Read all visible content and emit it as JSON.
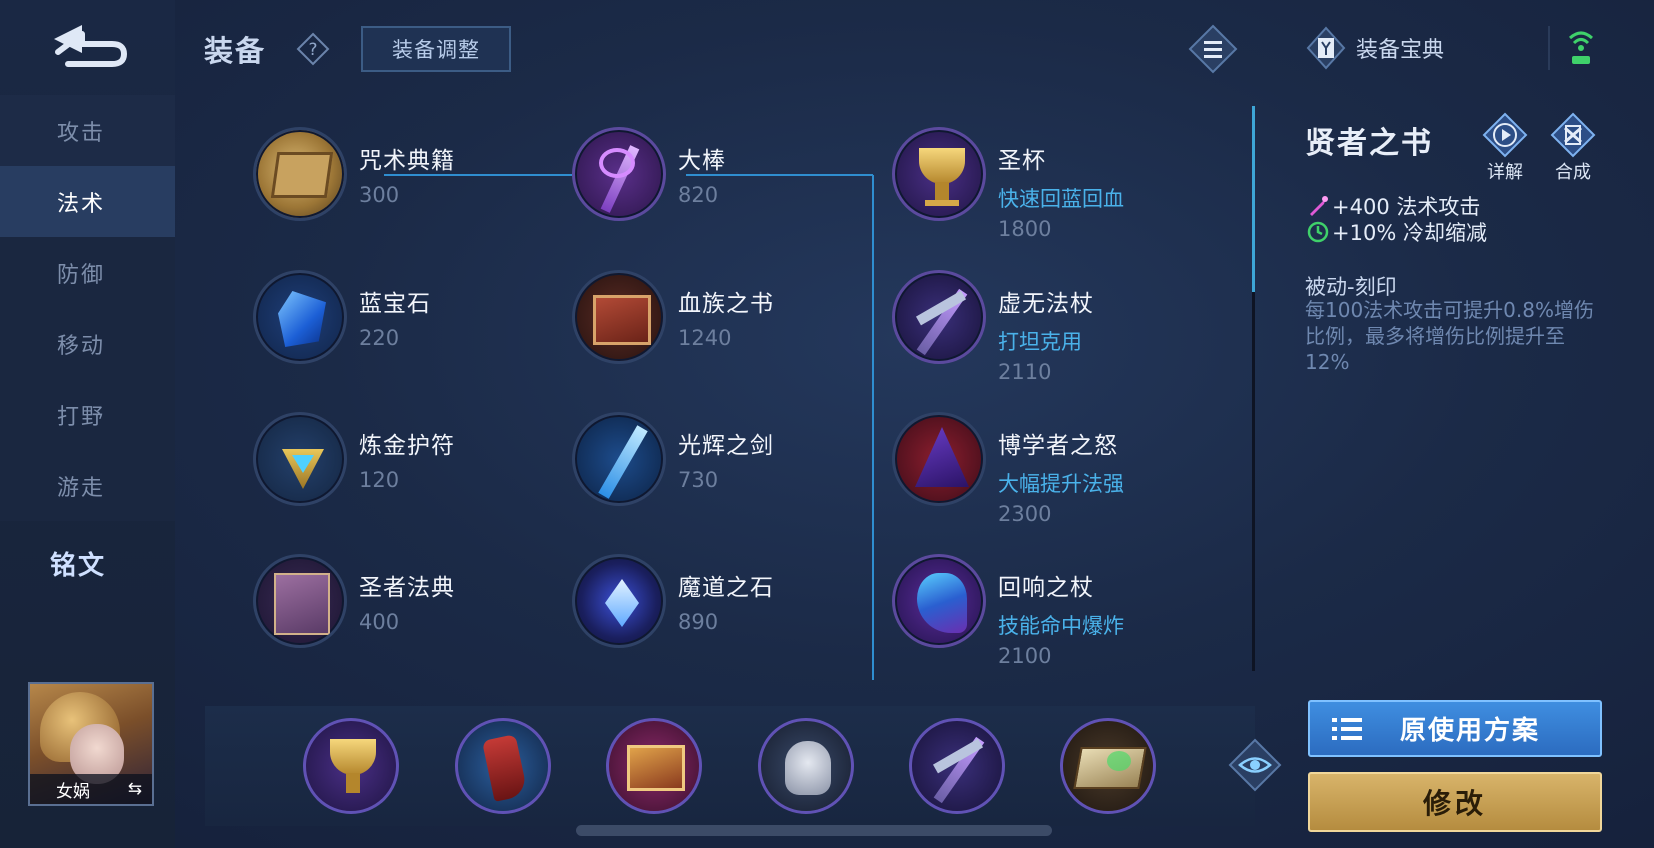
{
  "header": {
    "title": "装备",
    "adjust_button": "装备调整",
    "codex_label": "装备宝典"
  },
  "sidebar": {
    "items": [
      {
        "label": "攻击"
      },
      {
        "label": "法术"
      },
      {
        "label": "防御"
      },
      {
        "label": "移动"
      },
      {
        "label": "打野"
      },
      {
        "label": "游走"
      },
      {
        "label": "铭文"
      }
    ],
    "active": "法术",
    "hero_name": "女娲"
  },
  "items": {
    "col1": [
      {
        "name": "咒术典籍",
        "price": "300",
        "icon": "wooden-book-icon"
      },
      {
        "name": "蓝宝石",
        "price": "220",
        "icon": "blue-gem-icon"
      },
      {
        "name": "炼金护符",
        "price": "120",
        "icon": "amulet-icon"
      },
      {
        "name": "圣者法典",
        "price": "400",
        "icon": "purple-tome-icon"
      }
    ],
    "col2": [
      {
        "name": "大棒",
        "price": "820",
        "icon": "staff-icon"
      },
      {
        "name": "血族之书",
        "price": "1240",
        "icon": "blood-book-icon"
      },
      {
        "name": "光辉之剑",
        "price": "730",
        "icon": "radiant-sword-icon"
      },
      {
        "name": "魔道之石",
        "price": "890",
        "icon": "magic-stone-icon"
      }
    ],
    "col3": [
      {
        "name": "圣杯",
        "desc": "快速回蓝回血",
        "price": "1800",
        "icon": "holy-grail-icon"
      },
      {
        "name": "虚无法杖",
        "desc": "打坦克用",
        "price": "2110",
        "icon": "void-staff-icon"
      },
      {
        "name": "博学者之怒",
        "desc": "大幅提升法强",
        "price": "2300",
        "icon": "wizard-hat-icon"
      },
      {
        "name": "回响之杖",
        "desc": "技能命中爆炸",
        "price": "2100",
        "icon": "echo-staff-icon"
      }
    ]
  },
  "detail": {
    "title": "贤者之书",
    "detail_btn": "详解",
    "compose_btn": "合成",
    "stats": [
      {
        "text": "+400 法术攻击",
        "icon": "magic-attack-icon"
      },
      {
        "text": "+10% 冷却缩减",
        "icon": "cooldown-icon"
      }
    ],
    "passive_title": "被动-刻印",
    "passive_desc": "每100法术攻击可提升0.8%增伤比例，最多将增伤比例提升至12%"
  },
  "build": {
    "slots": [
      "holy-grail-icon",
      "boots-icon",
      "blood-book-icon",
      "skull-mask-icon",
      "void-staff-icon",
      "sage-book-icon"
    ],
    "scheme_button": "原使用方案",
    "edit_button": "修改"
  },
  "colors": {
    "accent_blue": "#4ab2ea",
    "button_blue": "#2c6cc0",
    "button_gold": "#c9a152",
    "background": "#1b2a47"
  }
}
